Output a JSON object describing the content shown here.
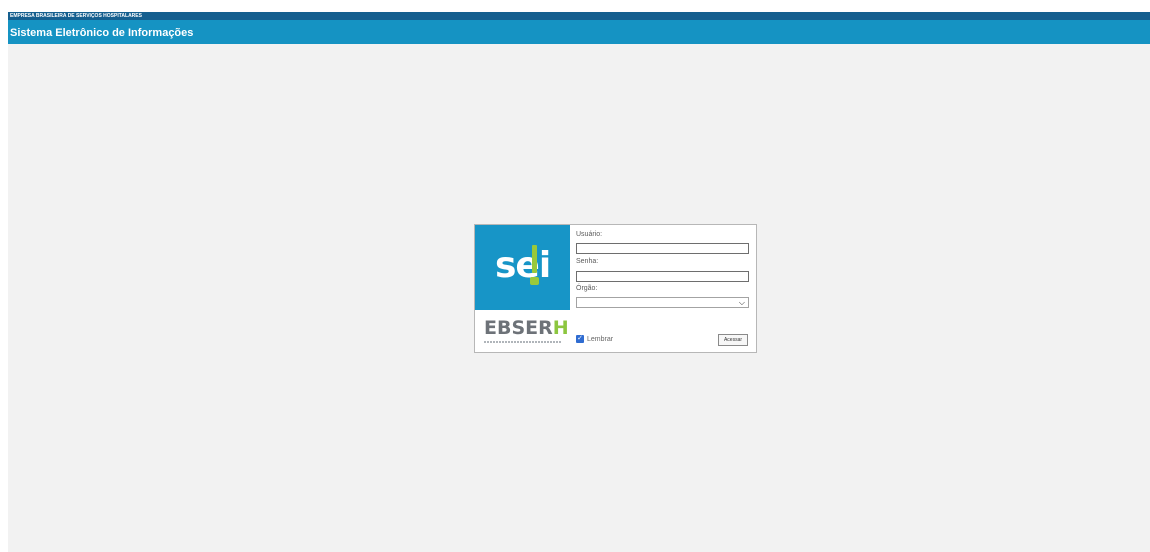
{
  "header": {
    "org_name": "EMPRESA BRASILEIRA DE SERVIÇOS HOSPITALARES",
    "system_title": "Sistema Eletrônico de Informações"
  },
  "login": {
    "logo_text": "sei",
    "partner_logo": "EBSERH",
    "username_label": "Usuário:",
    "password_label": "Senha:",
    "org_label": "Órgão:",
    "org_selected": "",
    "remember_label": "Lembrar",
    "remember_checked": true,
    "access_button": "Acessar"
  },
  "colors": {
    "org_bar": "#155f8f",
    "title_bar": "#1593c3",
    "sei_blue": "#1795c7",
    "sei_green": "#99c93b",
    "ebserh_gray": "#6d7278",
    "ebserh_green": "#8cc63f"
  }
}
